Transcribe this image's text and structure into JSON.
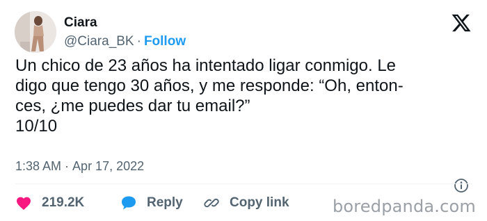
{
  "author": {
    "name": "Ciara",
    "handle": "@Ciara_BK",
    "separator": "·",
    "follow_label": "Follow",
    "avatar_icon": "profile-photo"
  },
  "brand_icon": "x-logo-icon",
  "tweet": {
    "text": "Un chico de 23 años ha intentado ligar conmigo. Le\ndigo que tengo 30 años, y me responde: “Oh, enton-\nces, ¿me puedes dar tu email?”\n10/10",
    "time": "1:38 AM",
    "separator": "·",
    "date": "Apr 17, 2022"
  },
  "actions": {
    "likes_count": "219.2K",
    "reply_label": "Reply",
    "copy_link_label": "Copy link"
  },
  "colors": {
    "accent": "#1d9bf0",
    "like": "#f91880",
    "muted": "#536471",
    "text": "#0f1419"
  },
  "watermark": "boredpanda.com"
}
